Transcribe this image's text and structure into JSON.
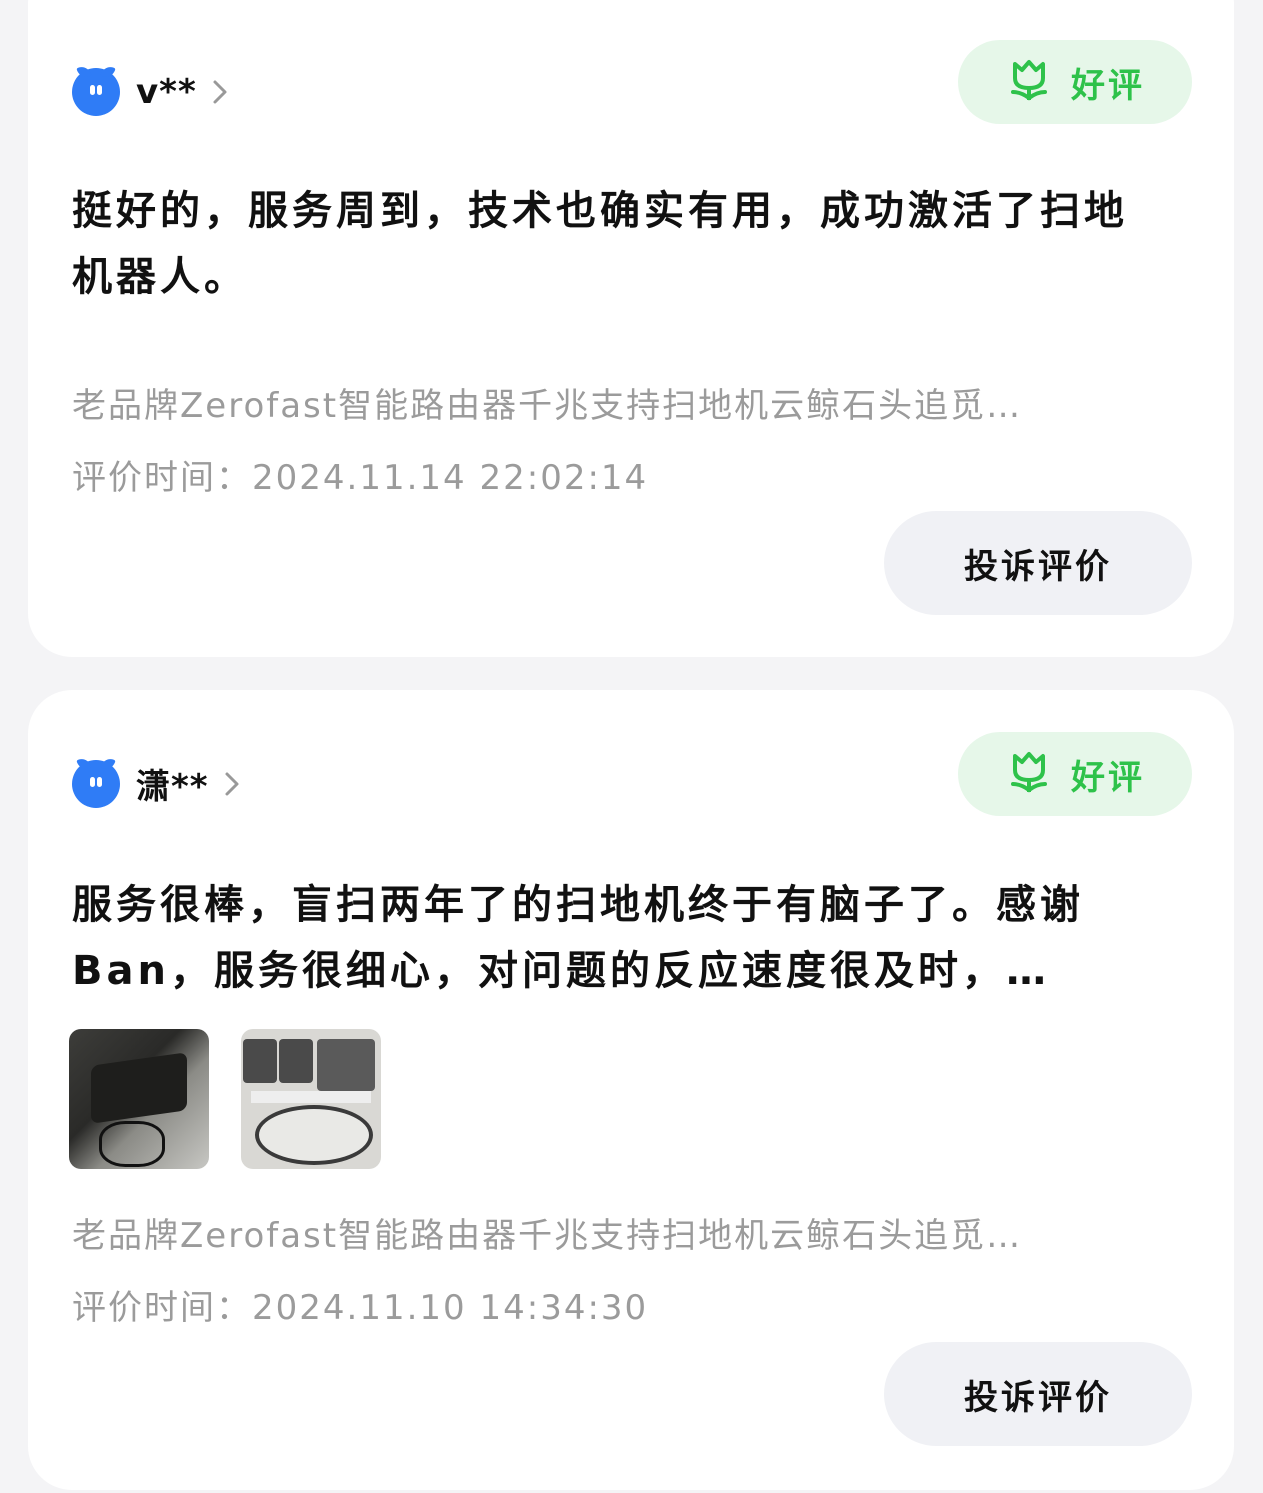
{
  "reviews": [
    {
      "username": "v**",
      "badge": "好评",
      "text": "挺好的，服务周到，技术也确实有用，成功激活了扫地机器人。",
      "product": "老品牌Zerofast智能路由器千兆支持扫地机云鲸石头追觅…",
      "time": "评价时间：2024.11.14 22:02:14",
      "complaint": "投诉评价"
    },
    {
      "username": "潇**",
      "badge": "好评",
      "text": "服务很棒，盲扫两年了的扫地机终于有脑子了。感谢Ban，服务很细心，对问题的反应速度很及时，…",
      "product": "老品牌Zerofast智能路由器千兆支持扫地机云鲸石头追觅…",
      "time": "评价时间：2024.11.10 14:34:30",
      "complaint": "投诉评价",
      "photos": [
        "router-photo",
        "robot-vacuum-photo"
      ]
    }
  ],
  "colors": {
    "badge_green": "#2ec24a",
    "badge_bg": "#e6f7e9",
    "avatar_blue": "#2f7cf6",
    "muted_text": "#9b9b9b"
  }
}
